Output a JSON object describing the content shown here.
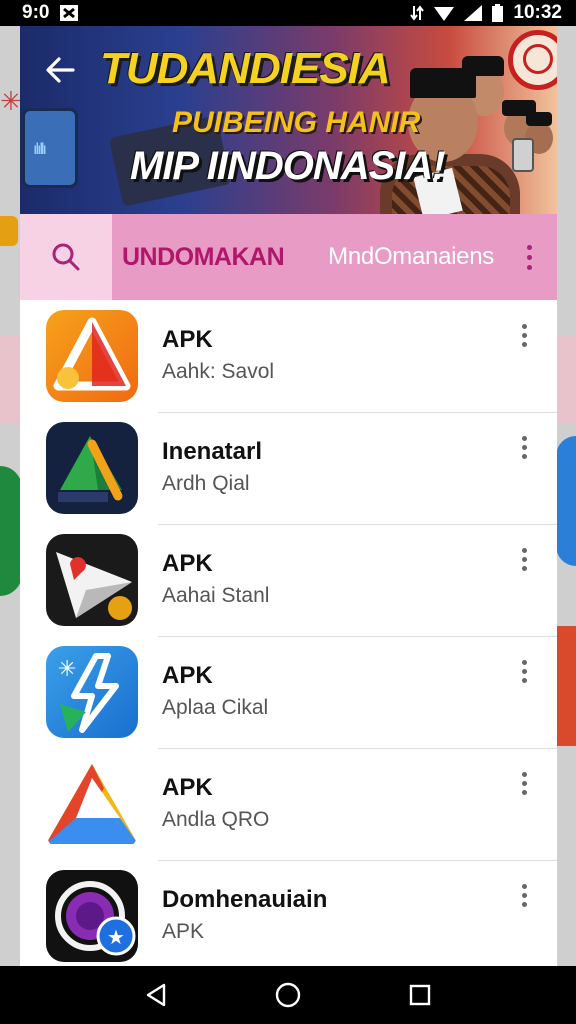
{
  "status_bar": {
    "time": "9:0",
    "clock": "10:32"
  },
  "banner": {
    "title": "TUDANDIESIA",
    "subtitle": "PUIBEING HANIR",
    "headline": "MIP IINDONASIA!"
  },
  "tab_bar": {
    "primary_label": "UNDOMAKAN",
    "secondary_label": "MndOmanaiens"
  },
  "apps": [
    {
      "name": "APK",
      "subtitle": "Aahk: Savol",
      "icon": "orange-triangle-icon"
    },
    {
      "name": "Inenatarl",
      "subtitle": "Ardh Qial",
      "icon": "green-triangle-icon"
    },
    {
      "name": "APK",
      "subtitle": "Aahai Stanl",
      "icon": "paper-plane-icon"
    },
    {
      "name": "APK",
      "subtitle": "Aplaa Cikal",
      "icon": "blue-lightning-icon"
    },
    {
      "name": "APK",
      "subtitle": "Andla QRO",
      "icon": "multicolor-triangle-icon"
    },
    {
      "name": "Domhenauiain",
      "subtitle": "APK",
      "icon": "purple-ring-star-icon"
    }
  ],
  "colors": {
    "tab_bar": "#e89bc5",
    "tab_primary_text": "#b0176a",
    "accent_dots": "#a8237a"
  }
}
